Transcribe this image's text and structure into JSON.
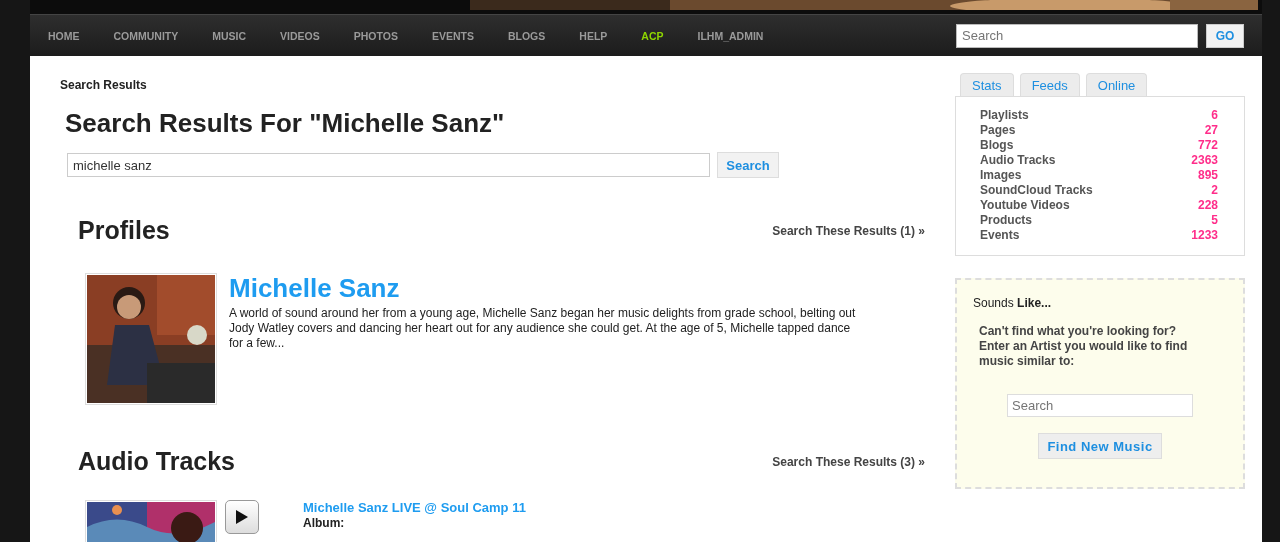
{
  "nav": {
    "items": [
      {
        "label": "HOME",
        "highlighted": false
      },
      {
        "label": "COMMUNITY",
        "highlighted": false
      },
      {
        "label": "MUSIC",
        "highlighted": false
      },
      {
        "label": "VIDEOS",
        "highlighted": false
      },
      {
        "label": "PHOTOS",
        "highlighted": false
      },
      {
        "label": "EVENTS",
        "highlighted": false
      },
      {
        "label": "BLOGS",
        "highlighted": false
      },
      {
        "label": "HELP",
        "highlighted": false
      },
      {
        "label": "ACP",
        "highlighted": true
      },
      {
        "label": "ILHM_ADMIN",
        "highlighted": false
      }
    ],
    "search": {
      "placeholder": "Search"
    },
    "go_button": "GO"
  },
  "breadcrumb": "Search Results",
  "heading": "Search Results For \"Michelle Sanz\"",
  "search": {
    "value": "michelle sanz",
    "button": "Search"
  },
  "sections": [
    {
      "title": "Profiles",
      "link": "Search These Results (1) »",
      "kind": "profile",
      "item": {
        "name": "Michelle Sanz",
        "description": "A world of sound around her from a young age, Michelle Sanz began her music delights from grade school, belting out Jody Watley covers and dancing her heart out for any audience she could get.  At the age of 5, Michelle tapped dance for a few..."
      }
    },
    {
      "title": "Audio Tracks",
      "link": "Search These Results (3) »",
      "kind": "track",
      "item": {
        "name": "Michelle Sanz LIVE @ Soul Camp 11",
        "album_label": "Album:"
      }
    }
  ],
  "sidebar": {
    "tabs": [
      "Stats",
      "Feeds",
      "Online"
    ],
    "stats": [
      {
        "label": "Playlists",
        "count": "6"
      },
      {
        "label": "Pages",
        "count": "27"
      },
      {
        "label": "Blogs",
        "count": "772"
      },
      {
        "label": "Audio Tracks",
        "count": "2363"
      },
      {
        "label": "Images",
        "count": "895"
      },
      {
        "label": "SoundCloud Tracks",
        "count": "2"
      },
      {
        "label": "Youtube Videos",
        "count": "228"
      },
      {
        "label": "Products",
        "count": "5"
      },
      {
        "label": "Events",
        "count": "1233"
      }
    ],
    "sounds_like": {
      "title": "Sounds **Like...**",
      "prompt": "Can't find what you're looking for? Enter an Artist you would like to find music similar to:",
      "placeholder": "Search",
      "button": "Find New Music"
    }
  }
}
